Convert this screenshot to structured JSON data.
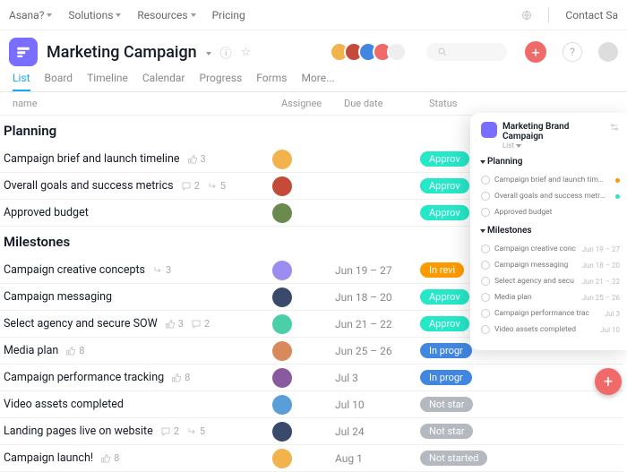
{
  "nav": {
    "asana": "Asana?",
    "solutions": "Solutions",
    "resources": "Resources",
    "pricing": "Pricing",
    "contact": "Contact Sa"
  },
  "project": {
    "title": "Marketing Campaign"
  },
  "tabs": [
    "List",
    "Board",
    "Timeline",
    "Calendar",
    "Progress",
    "Forms",
    "More..."
  ],
  "cols": {
    "name": "name",
    "assignee": "Assignee",
    "due": "Due date",
    "status": "Status"
  },
  "sections": [
    {
      "title": "Planning",
      "tasks": [
        {
          "name": "Campaign brief and launch timeline",
          "likes": "3",
          "a": "#f2b34c",
          "st": "Approv",
          "sc": "p-approved"
        },
        {
          "name": "Overall goals and success metrics",
          "comments": "2",
          "sub": "5",
          "a": "#c44b3a",
          "st": "Approv",
          "sc": "p-approved"
        },
        {
          "name": "Approved budget",
          "a": "#6b8b4e",
          "st": "Approv",
          "sc": "p-approved"
        }
      ]
    },
    {
      "title": "Milestones",
      "tasks": [
        {
          "name": "Campaign creative concepts",
          "sub": "3",
          "a": "#9b8cf0",
          "due": "Jun 19 – 27",
          "st": "In revi",
          "sc": "p-review"
        },
        {
          "name": "Campaign messaging",
          "a": "#3a4a6b",
          "due": "Jun 18 – 20",
          "st": "Approv",
          "sc": "p-approved"
        },
        {
          "name": "Select agency and secure SOW",
          "likes": "3",
          "comments": "2",
          "a": "#4acfa8",
          "due": "Jun 21 – 22",
          "st": "Approv",
          "sc": "p-approved"
        },
        {
          "name": "Media plan",
          "likes": "8",
          "a": "#d88a5a",
          "due": "Jun 25 – 26",
          "st": "In progr",
          "sc": "p-progress"
        },
        {
          "name": "Campaign performance tracking",
          "likes": "8",
          "a": "#8a5a9e",
          "due": "Jul 3",
          "st": "In progr",
          "sc": "p-progress"
        },
        {
          "name": "Video assets completed",
          "a": "#5a9ed8",
          "due": "Jul 10",
          "st": "Not star",
          "sc": "p-not"
        },
        {
          "name": "Landing pages live on website",
          "comments": "2",
          "sub": "5",
          "a": "#3a4a6b",
          "due": "Jul 24",
          "st": "Not star",
          "sc": "p-not"
        },
        {
          "name": "Campaign launch!",
          "likes": "8",
          "a": "#f2b34c",
          "due": "Aug 1",
          "st": "Not started",
          "sc": "p-not"
        }
      ]
    }
  ],
  "overlay": {
    "title": "Marketing Brand Campaign",
    "sub": "List",
    "sections": [
      {
        "title": "Planning",
        "rows": [
          {
            "t": "Campaign brief and launch timeline",
            "d": "",
            "c": "#fd9a00"
          },
          {
            "t": "Overall goals and success metrics",
            "d": "",
            "c": "#25e8c8"
          },
          {
            "t": "Approved budget",
            "d": "",
            "c": ""
          }
        ]
      },
      {
        "title": "Milestones",
        "rows": [
          {
            "t": "Campaign creative conc",
            "d": "Jun 19 – 27",
            "c": ""
          },
          {
            "t": "Campaign messaging",
            "d": "Jun 18 – 20",
            "c": ""
          },
          {
            "t": "Select agency and secu",
            "d": "Jun 21 – 22",
            "c": ""
          },
          {
            "t": "Media plan",
            "d": "Jun 25 – 26",
            "c": ""
          },
          {
            "t": "Campaign performance trac",
            "d": "Jul 3",
            "c": ""
          },
          {
            "t": "Video assets completed",
            "d": "Jul 10",
            "c": ""
          }
        ]
      }
    ]
  }
}
